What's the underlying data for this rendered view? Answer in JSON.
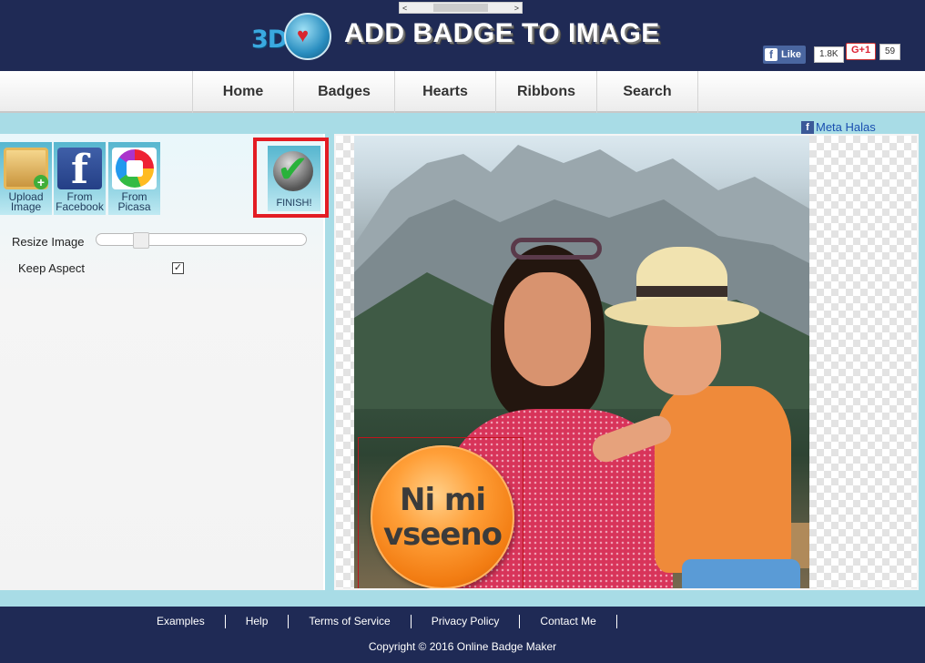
{
  "header": {
    "logo_prefix": "3D",
    "title": "ADD BADGE TO IMAGE",
    "top_scroll_left": "<",
    "top_scroll_right": ">",
    "fb_like_label": "Like",
    "fb_like_count": "1.8K",
    "gplus_label": "G+1",
    "gplus_count": "59"
  },
  "nav": {
    "items": [
      "Home",
      "Badges",
      "Hearts",
      "Ribbons",
      "Search"
    ]
  },
  "sources": {
    "upload_label": "Upload Image",
    "facebook_label": "From Facebook",
    "picasa_label": "From Picasa",
    "finish_label": "FINISH!"
  },
  "controls": {
    "resize_label": "Resize Image",
    "resize_value": 0.19,
    "keep_aspect_label": "Keep Aspect",
    "keep_aspect_checked": true
  },
  "author": {
    "name": "Meta Halas"
  },
  "badge": {
    "line1": "Ni mi",
    "line2": "vseeno",
    "color": "#f27c12"
  },
  "footer": {
    "links": [
      "Examples",
      "Help",
      "Terms of Service",
      "Privacy Policy",
      "Contact Me"
    ],
    "copyright": "Copyright © 2016 Online Badge Maker"
  },
  "colors": {
    "header_bg": "#1f2a55",
    "page_bg": "#a8dce6",
    "finish_highlight": "#e31c24"
  },
  "icons": {
    "facebook": "facebook-icon",
    "upload": "upload-image-icon",
    "picasa": "picasa-icon",
    "finish": "checkmark-icon"
  }
}
